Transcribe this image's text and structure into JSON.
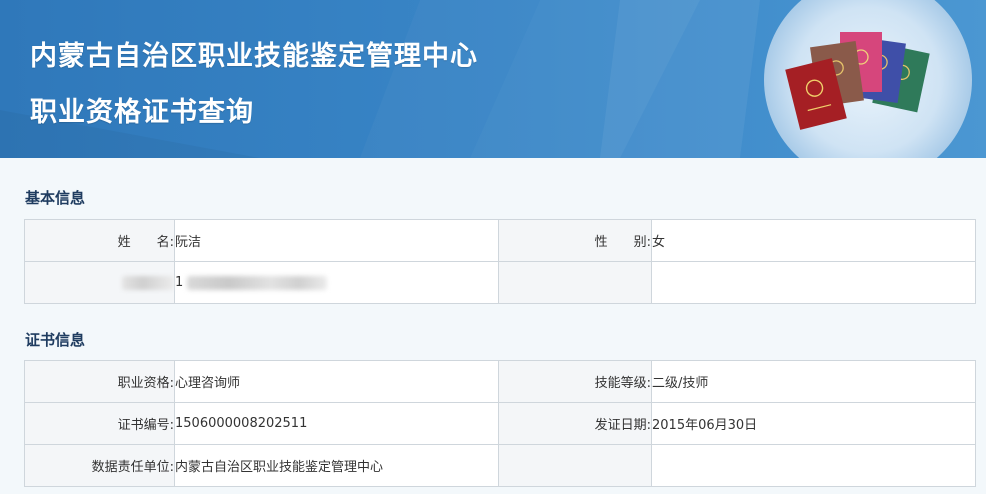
{
  "header": {
    "title_line1": "内蒙古自治区职业技能鉴定管理中心",
    "title_line2": "职业资格证书查询"
  },
  "basic_info": {
    "section_title": "基本信息",
    "name_label": "姓　　名:",
    "name_value": "阮洁",
    "gender_label": "性　　别:",
    "gender_value": "女",
    "id_value_visible_prefix": "1"
  },
  "certificate_info": {
    "section_title": "证书信息",
    "qualification_label": "职业资格:",
    "qualification_value": "心理咨询师",
    "skill_level_label": "技能等级:",
    "skill_level_value": "二级/技师",
    "cert_number_label": "证书编号:",
    "cert_number_value": "1506000008202511",
    "issue_date_label": "发证日期:",
    "issue_date_value": "2015年06月30日",
    "responsible_unit_label": "数据责任单位:",
    "responsible_unit_value": "内蒙古自治区职业技能鉴定管理中心"
  },
  "colors": {
    "header_blue": "#3a87c8",
    "section_title": "#1f3c60",
    "label_bg": "#f4f6f8",
    "border": "#cfd6dc"
  }
}
